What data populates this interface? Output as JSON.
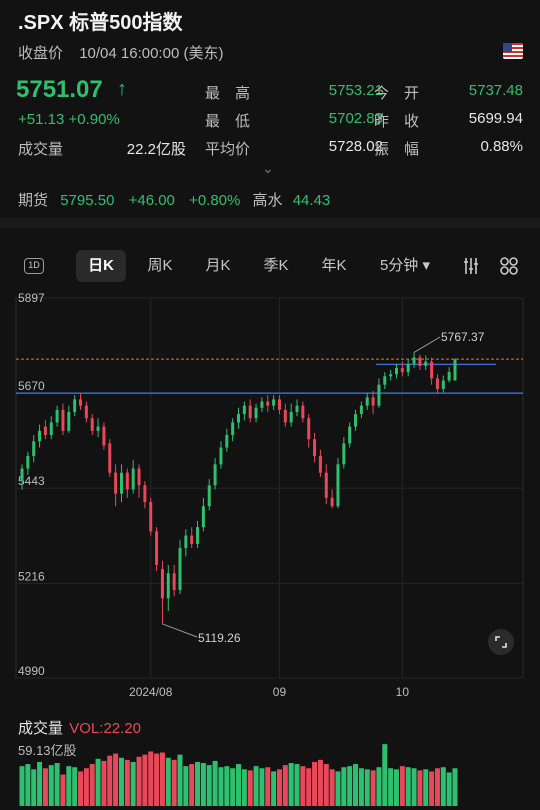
{
  "header": {
    "symbol_title": ".SPX  标普500指数",
    "close_label": "收盘价",
    "close_time": "10/04 16:00:00 (美东)",
    "flag_icon": "us-flag-icon"
  },
  "quote": {
    "price": "5751.07",
    "change": "+51.13  +0.90%",
    "high_label": "最　高",
    "high": "5753.21",
    "open_label": "今　开",
    "open": "5737.48",
    "low_label": "最　低",
    "low": "5702.83",
    "prev_close_label": "昨　收",
    "prev_close": "5699.94",
    "volume_label": "成交量",
    "volume": "22.2亿股",
    "avg_label": "平均价",
    "avg": "5728.02",
    "amplitude_label": "振　幅",
    "amplitude": "0.88%"
  },
  "futures": {
    "label": "期货",
    "price": "5795.50",
    "change": "+46.00",
    "pct": "+0.80%",
    "premium_label": "高水",
    "premium": "44.43"
  },
  "tabs": {
    "icon_1d": "1D",
    "day": "日K",
    "week": "周K",
    "month": "月K",
    "quarter": "季K",
    "year": "年K",
    "minute": "5分钟 ▾"
  },
  "colors": {
    "up": "#2fbf71",
    "down": "#e8485a",
    "line_blue": "#3f7fe6",
    "line_orange": "#e07b30"
  },
  "chart": {
    "y_ticks": [
      "5897",
      "5670",
      "5443",
      "5216",
      "4990"
    ],
    "x_ticks": [
      "2024/08",
      "09",
      "10"
    ],
    "high_annotation": "5767.37",
    "low_annotation": "5119.26",
    "blue_line_upper": 5767.37,
    "blue_line_lower": 5670,
    "orange_line": 5751.07
  },
  "chart_data": {
    "type": "candlestick",
    "ylim": [
      4990,
      5897
    ],
    "y_ticks": [
      5897,
      5670,
      5443,
      5216,
      4990
    ],
    "x_ticks": [
      "2024/08",
      "09",
      "10"
    ],
    "annotations": {
      "max_high": 5767.37,
      "min_low": 5119.26
    },
    "candles": [
      {
        "o": 5460,
        "c": 5490,
        "h": 5500,
        "l": 5440
      },
      {
        "o": 5490,
        "c": 5520,
        "h": 5530,
        "l": 5475
      },
      {
        "o": 5520,
        "c": 5555,
        "h": 5570,
        "l": 5505
      },
      {
        "o": 5555,
        "c": 5580,
        "h": 5595,
        "l": 5540
      },
      {
        "o": 5590,
        "c": 5570,
        "h": 5605,
        "l": 5560
      },
      {
        "o": 5570,
        "c": 5600,
        "h": 5615,
        "l": 5560
      },
      {
        "o": 5600,
        "c": 5630,
        "h": 5640,
        "l": 5590
      },
      {
        "o": 5630,
        "c": 5580,
        "h": 5645,
        "l": 5570
      },
      {
        "o": 5580,
        "c": 5625,
        "h": 5640,
        "l": 5575
      },
      {
        "o": 5625,
        "c": 5655,
        "h": 5665,
        "l": 5615
      },
      {
        "o": 5655,
        "c": 5640,
        "h": 5670,
        "l": 5630
      },
      {
        "o": 5640,
        "c": 5610,
        "h": 5650,
        "l": 5600
      },
      {
        "o": 5610,
        "c": 5580,
        "h": 5620,
        "l": 5570
      },
      {
        "o": 5580,
        "c": 5590,
        "h": 5610,
        "l": 5565
      },
      {
        "o": 5590,
        "c": 5545,
        "h": 5600,
        "l": 5535
      },
      {
        "o": 5550,
        "c": 5480,
        "h": 5560,
        "l": 5470
      },
      {
        "o": 5480,
        "c": 5430,
        "h": 5500,
        "l": 5400
      },
      {
        "o": 5430,
        "c": 5480,
        "h": 5500,
        "l": 5410
      },
      {
        "o": 5480,
        "c": 5440,
        "h": 5490,
        "l": 5420
      },
      {
        "o": 5440,
        "c": 5490,
        "h": 5510,
        "l": 5430
      },
      {
        "o": 5490,
        "c": 5450,
        "h": 5500,
        "l": 5420
      },
      {
        "o": 5450,
        "c": 5410,
        "h": 5460,
        "l": 5395
      },
      {
        "o": 5410,
        "c": 5340,
        "h": 5420,
        "l": 5330
      },
      {
        "o": 5340,
        "c": 5260,
        "h": 5350,
        "l": 5245
      },
      {
        "o": 5250,
        "c": 5180,
        "h": 5270,
        "l": 5119
      },
      {
        "o": 5180,
        "c": 5240,
        "h": 5260,
        "l": 5150
      },
      {
        "o": 5240,
        "c": 5200,
        "h": 5260,
        "l": 5185
      },
      {
        "o": 5200,
        "c": 5300,
        "h": 5320,
        "l": 5190
      },
      {
        "o": 5300,
        "c": 5330,
        "h": 5345,
        "l": 5280
      },
      {
        "o": 5330,
        "c": 5310,
        "h": 5350,
        "l": 5300
      },
      {
        "o": 5310,
        "c": 5350,
        "h": 5365,
        "l": 5300
      },
      {
        "o": 5350,
        "c": 5400,
        "h": 5420,
        "l": 5340
      },
      {
        "o": 5400,
        "c": 5450,
        "h": 5465,
        "l": 5390
      },
      {
        "o": 5450,
        "c": 5500,
        "h": 5515,
        "l": 5440
      },
      {
        "o": 5500,
        "c": 5540,
        "h": 5555,
        "l": 5490
      },
      {
        "o": 5540,
        "c": 5570,
        "h": 5585,
        "l": 5530
      },
      {
        "o": 5570,
        "c": 5600,
        "h": 5610,
        "l": 5555
      },
      {
        "o": 5600,
        "c": 5620,
        "h": 5635,
        "l": 5585
      },
      {
        "o": 5620,
        "c": 5640,
        "h": 5650,
        "l": 5605
      },
      {
        "o": 5640,
        "c": 5610,
        "h": 5655,
        "l": 5600
      },
      {
        "o": 5610,
        "c": 5635,
        "h": 5645,
        "l": 5600
      },
      {
        "o": 5635,
        "c": 5650,
        "h": 5660,
        "l": 5625
      },
      {
        "o": 5650,
        "c": 5640,
        "h": 5665,
        "l": 5625
      },
      {
        "o": 5640,
        "c": 5655,
        "h": 5665,
        "l": 5630
      },
      {
        "o": 5655,
        "c": 5630,
        "h": 5665,
        "l": 5620
      },
      {
        "o": 5630,
        "c": 5600,
        "h": 5645,
        "l": 5590
      },
      {
        "o": 5600,
        "c": 5625,
        "h": 5645,
        "l": 5590
      },
      {
        "o": 5625,
        "c": 5640,
        "h": 5655,
        "l": 5615
      },
      {
        "o": 5640,
        "c": 5610,
        "h": 5650,
        "l": 5600
      },
      {
        "o": 5610,
        "c": 5560,
        "h": 5620,
        "l": 5540
      },
      {
        "o": 5560,
        "c": 5520,
        "h": 5575,
        "l": 5505
      },
      {
        "o": 5520,
        "c": 5480,
        "h": 5535,
        "l": 5470
      },
      {
        "o": 5480,
        "c": 5420,
        "h": 5500,
        "l": 5405
      },
      {
        "o": 5420,
        "c": 5400,
        "h": 5440,
        "l": 5395
      },
      {
        "o": 5400,
        "c": 5500,
        "h": 5515,
        "l": 5395
      },
      {
        "o": 5500,
        "c": 5550,
        "h": 5565,
        "l": 5490
      },
      {
        "o": 5550,
        "c": 5590,
        "h": 5600,
        "l": 5540
      },
      {
        "o": 5590,
        "c": 5620,
        "h": 5630,
        "l": 5580
      },
      {
        "o": 5620,
        "c": 5640,
        "h": 5650,
        "l": 5610
      },
      {
        "o": 5640,
        "c": 5660,
        "h": 5670,
        "l": 5630
      },
      {
        "o": 5660,
        "c": 5640,
        "h": 5675,
        "l": 5620
      },
      {
        "o": 5640,
        "c": 5690,
        "h": 5705,
        "l": 5635
      },
      {
        "o": 5690,
        "c": 5710,
        "h": 5720,
        "l": 5680
      },
      {
        "o": 5710,
        "c": 5715,
        "h": 5725,
        "l": 5700
      },
      {
        "o": 5715,
        "c": 5730,
        "h": 5740,
        "l": 5705
      },
      {
        "o": 5730,
        "c": 5720,
        "h": 5745,
        "l": 5710
      },
      {
        "o": 5720,
        "c": 5740,
        "h": 5750,
        "l": 5710
      },
      {
        "o": 5740,
        "c": 5755,
        "h": 5767,
        "l": 5730
      },
      {
        "o": 5755,
        "c": 5735,
        "h": 5762,
        "l": 5725
      },
      {
        "o": 5735,
        "c": 5745,
        "h": 5760,
        "l": 5725
      },
      {
        "o": 5745,
        "c": 5705,
        "h": 5755,
        "l": 5690
      },
      {
        "o": 5705,
        "c": 5680,
        "h": 5715,
        "l": 5670
      },
      {
        "o": 5680,
        "c": 5700,
        "h": 5712,
        "l": 5672
      },
      {
        "o": 5700,
        "c": 5720,
        "h": 5732,
        "l": 5695
      },
      {
        "o": 5700,
        "c": 5751,
        "h": 5753,
        "l": 5703
      }
    ]
  },
  "volume": {
    "title_label": "成交量",
    "vol_value": "VOL:22.20",
    "max_label": "59.13亿股",
    "chart_data": {
      "type": "bar",
      "ylim": [
        0,
        59.13
      ],
      "values": [
        38,
        40,
        35,
        42,
        36,
        39,
        41,
        30,
        38,
        37,
        33,
        36,
        40,
        45,
        43,
        48,
        50,
        46,
        44,
        42,
        47,
        49,
        52,
        50,
        51,
        46,
        44,
        49,
        38,
        40,
        42,
        41,
        39,
        43,
        37,
        38,
        36,
        40,
        35,
        34,
        38,
        36,
        37,
        33,
        35,
        39,
        41,
        40,
        38,
        36,
        42,
        44,
        40,
        35,
        33,
        37,
        38,
        40,
        36,
        35,
        34,
        37,
        59,
        36,
        35,
        38,
        37,
        36,
        34,
        35,
        33,
        36,
        37,
        32,
        36
      ]
    }
  }
}
